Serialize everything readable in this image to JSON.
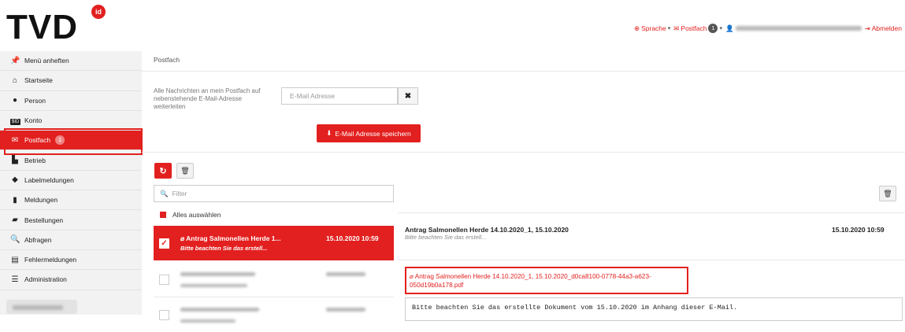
{
  "brand": {
    "logo_text": "TVD",
    "logo_badge": "id"
  },
  "topnav": {
    "language_label": "Sprache",
    "mailbox_label": "Postfach",
    "mailbox_count": "1",
    "logout_label": "Abmelden"
  },
  "sidebar": {
    "items": [
      {
        "label": "Menü anheften",
        "icon": "pin-icon"
      },
      {
        "label": "Startseite",
        "icon": "home-icon"
      },
      {
        "label": "Person",
        "icon": "user-icon"
      },
      {
        "label": "Konto",
        "icon": "account-icon"
      },
      {
        "label": "Postfach",
        "icon": "envelope-icon",
        "count": "1",
        "active": true
      },
      {
        "label": "Betrieb",
        "icon": "factory-icon"
      },
      {
        "label": "Labelmeldungen",
        "icon": "tag-icon"
      },
      {
        "label": "Meldungen",
        "icon": "clipboard-icon"
      },
      {
        "label": "Bestellungen",
        "icon": "shopping-bag-icon"
      },
      {
        "label": "Abfragen",
        "icon": "search-icon"
      },
      {
        "label": "Fehlermeldungen",
        "icon": "list-icon"
      },
      {
        "label": "Administration",
        "icon": "sliders-icon"
      }
    ],
    "konto_icon_text": "$ID"
  },
  "main": {
    "breadcrumb": "Postfach",
    "forward_label": "Alle Nachrichten an mein Postfach auf nebenstehende E-Mail-Adresse weiterleiten",
    "email_placeholder": "E-Mail Adresse",
    "save_button": "E-Mail Adresse speichern",
    "filter_placeholder": "Filter",
    "select_all_label": "Alles auswählen",
    "messages": [
      {
        "subject": "Antrag Salmonellen Herde 1...",
        "preview": "Bitte beachten Sie das erstell...",
        "date": "15.10.2020 10:59",
        "selected": true
      }
    ]
  },
  "detail": {
    "subject": "Antrag Salmonellen Herde 14.10.2020_1, 15.10.2020",
    "preview": "Bitte beachten Sie das erstell...",
    "date": "15.10.2020 10:59",
    "attachment_line1": "Antrag Salmonellen Herde 14.10.2020_1, 15.10.2020_d0ca8100-0778-44a3-a623-",
    "attachment_line2": "050d19b0a178.pdf",
    "body": "Bitte beachten Sie das erstellte Dokument vom 15.10.2020 im Anhang dieser E-Mail."
  },
  "colors": {
    "accent": "#e2201f"
  }
}
